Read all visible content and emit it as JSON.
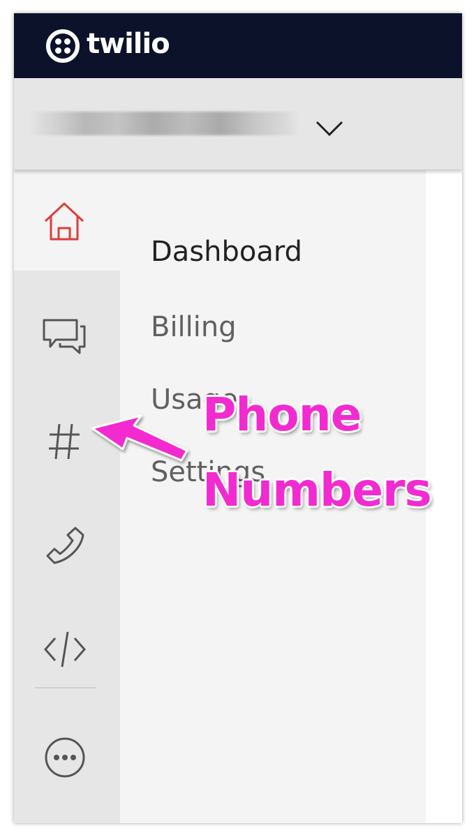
{
  "header": {
    "brand": "twilio",
    "logo_icon": "twilio-logo-icon",
    "background": "#0d122b"
  },
  "account_switcher": {
    "account_name_redacted": true,
    "chevron_icon": "chevron-down-icon"
  },
  "icon_rail": {
    "items": [
      {
        "icon": "home-icon",
        "active": true,
        "accent": "#e03c3c"
      },
      {
        "icon": "chat-bubbles-icon",
        "active": false
      },
      {
        "icon": "hash-icon",
        "active": false
      },
      {
        "icon": "phone-icon",
        "active": false
      },
      {
        "icon": "code-icon",
        "active": false
      },
      {
        "icon": "more-icon",
        "active": false
      }
    ]
  },
  "menu": {
    "items": [
      {
        "label": "Dashboard",
        "active": true
      },
      {
        "label": "Billing",
        "active": false
      },
      {
        "label": "Usage",
        "active": false
      },
      {
        "label": "Settings",
        "active": false
      }
    ]
  },
  "annotation": {
    "line1": "Phone",
    "line2": "Numbers",
    "color": "#f22bd0",
    "arrow_target": "hash-icon"
  }
}
